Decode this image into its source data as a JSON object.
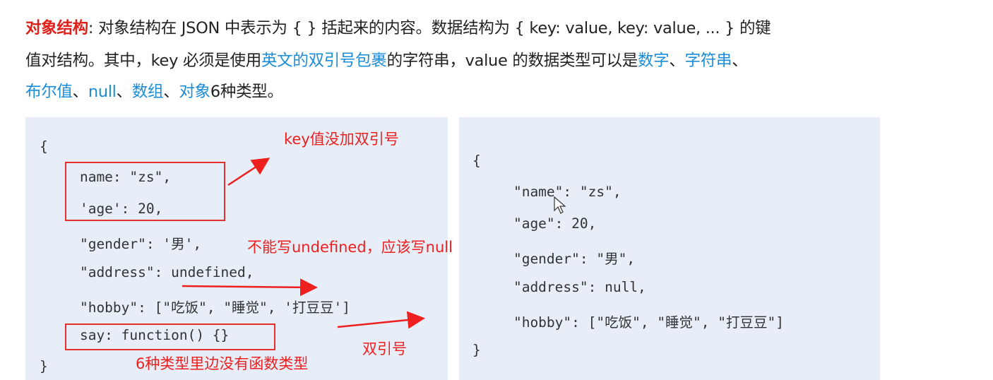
{
  "intro": {
    "line1": {
      "term": "对象结构",
      "text": ": 对象结构在 JSON 中表示为 { } 括起来的内容。数据结构为 { key: value, key: value, ... } 的键"
    },
    "line2": {
      "a": "值对结构。其中，key 必须是使用",
      "b": "英文的双引号包裹",
      "c": "的字符串，value 的数据类型可以是",
      "d": "数字",
      "e": "、",
      "f": "字符串",
      "g": "、"
    },
    "line3": {
      "a": "布尔值",
      "b": "、",
      "c": "null",
      "d": "、",
      "e": "数组",
      "f": "、",
      "g": "对象",
      "h": "6种类型。"
    }
  },
  "wrong_example": {
    "lines": [
      "{",
      "    name: \"zs\",",
      "    'age': 20,",
      "    \"gender\": '男',",
      "    \"address\": undefined,",
      "    \"hobby\": [\"吃饭\", \"睡觉\", '打豆豆']",
      "    say: function() {}",
      "}"
    ]
  },
  "correct_example": {
    "lines": [
      "{",
      "    \"name\": \"zs\",",
      "    \"age\": 20,",
      "    \"gender\": \"男\",",
      "    \"address\": null,",
      "    \"hobby\": [\"吃饭\", \"睡觉\", \"打豆豆\"]",
      "}"
    ]
  },
  "annotations": {
    "key_no_quotes": "key值没加双引号",
    "no_undefined": "不能写undefined，应该写null",
    "double_quotes": "双引号",
    "no_function": "6种类型里边没有函数类型"
  },
  "colors": {
    "annotation_red": "#ee1f1f",
    "link_blue": "#1b8cd8",
    "panel_bg": "#e7eef8"
  }
}
